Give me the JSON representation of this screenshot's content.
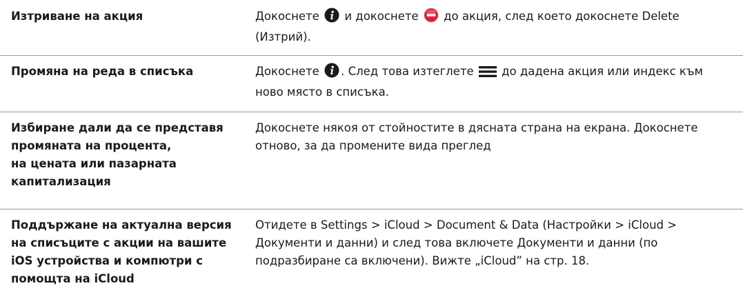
{
  "rows": [
    {
      "action": "Изтриване на акция",
      "desc_part1": "Докоснете ",
      "desc_part2": " и докоснете ",
      "desc_part3": " до акция, след което докоснете Delete (Изтрий)."
    },
    {
      "action": "Промяна на реда в списъка",
      "desc_part1": "Докоснете ",
      "desc_part2": ". След това изтеглете ",
      "desc_part3": " до дадена акция или индекс към ново място в списъка."
    },
    {
      "action_lines": [
        "Избиране дали да се представя",
        "промяната на процента,",
        "на цената или пазарната",
        "капитализация"
      ],
      "desc": "Докоснете някоя от стойностите в дясната страна на екрана. Докоснете отново, за да промените вида преглед"
    },
    {
      "action_lines": [
        "Поддържане на актуална версия",
        "на списъците с акции на вашите",
        "iOS устройства и компютри с",
        "помощта на iCloud"
      ],
      "desc": "Отидете в Settings > iCloud > Document & Data (Настройки > iCloud > Документи и данни) и след това включете Документи и данни (по подразбиране са включени). Вижте „iCloud” на стр. 18."
    }
  ],
  "icons": {
    "info": "info-icon",
    "delete": "delete-circle-icon",
    "reorder": "reorder-handle-icon"
  },
  "colors": {
    "delete_red": "#e0203a",
    "divider": "#9a9a9a",
    "text": "#1a1a1a"
  }
}
